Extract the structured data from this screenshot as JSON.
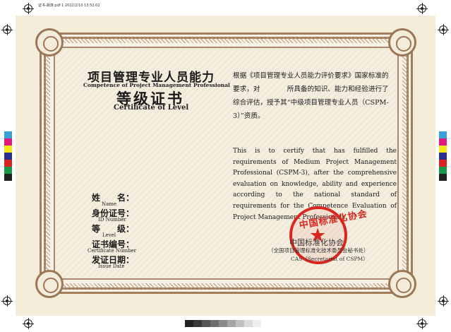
{
  "file_header": "证书-胡涛.pdf   1   2022/2/10   13:52:02",
  "title_cn": "项目管理专业人员能力",
  "title_en": "Competence of Project Management Professional",
  "level_cn": "等级证书",
  "level_en": "Certificate of Level",
  "fields": [
    {
      "cn": "姓　　名：",
      "en": "Name"
    },
    {
      "cn": "身份证号：",
      "en": "ID Number"
    },
    {
      "cn": "等　　级：",
      "en": "Level"
    },
    {
      "cn": "证书编号：",
      "en": "Certificate Number"
    },
    {
      "cn": "发证日期：",
      "en": "Issue Date"
    }
  ],
  "body_cn": "根据《项目管理专业人员能力评价要求》国家标准的要求，对　　　　所具备的知识、能力和经验进行了综合评估，授予其“中级项目管理专业人员（CSPM-3）”资质。",
  "body_en": "This is to certify that                         has fulfilled the requirements of Medium Project Management Professional (CSPM-3), after the comprehensive evaluation on knowledge, ability and experience according to the national standard of requirements for the Competence Evaluation of Project Management Professionals.",
  "seal_text": "中国标准化协会",
  "issuer_cn": "中国标准化协会",
  "issuer_sub": "（全国项目管理标准化技术委员会秘书处）",
  "issuer_en": "CAS（Secretariat of CSPM）",
  "colors": {
    "paper": "#f3ecd9",
    "border": "#a07e5d",
    "seal": "#d9261e"
  }
}
